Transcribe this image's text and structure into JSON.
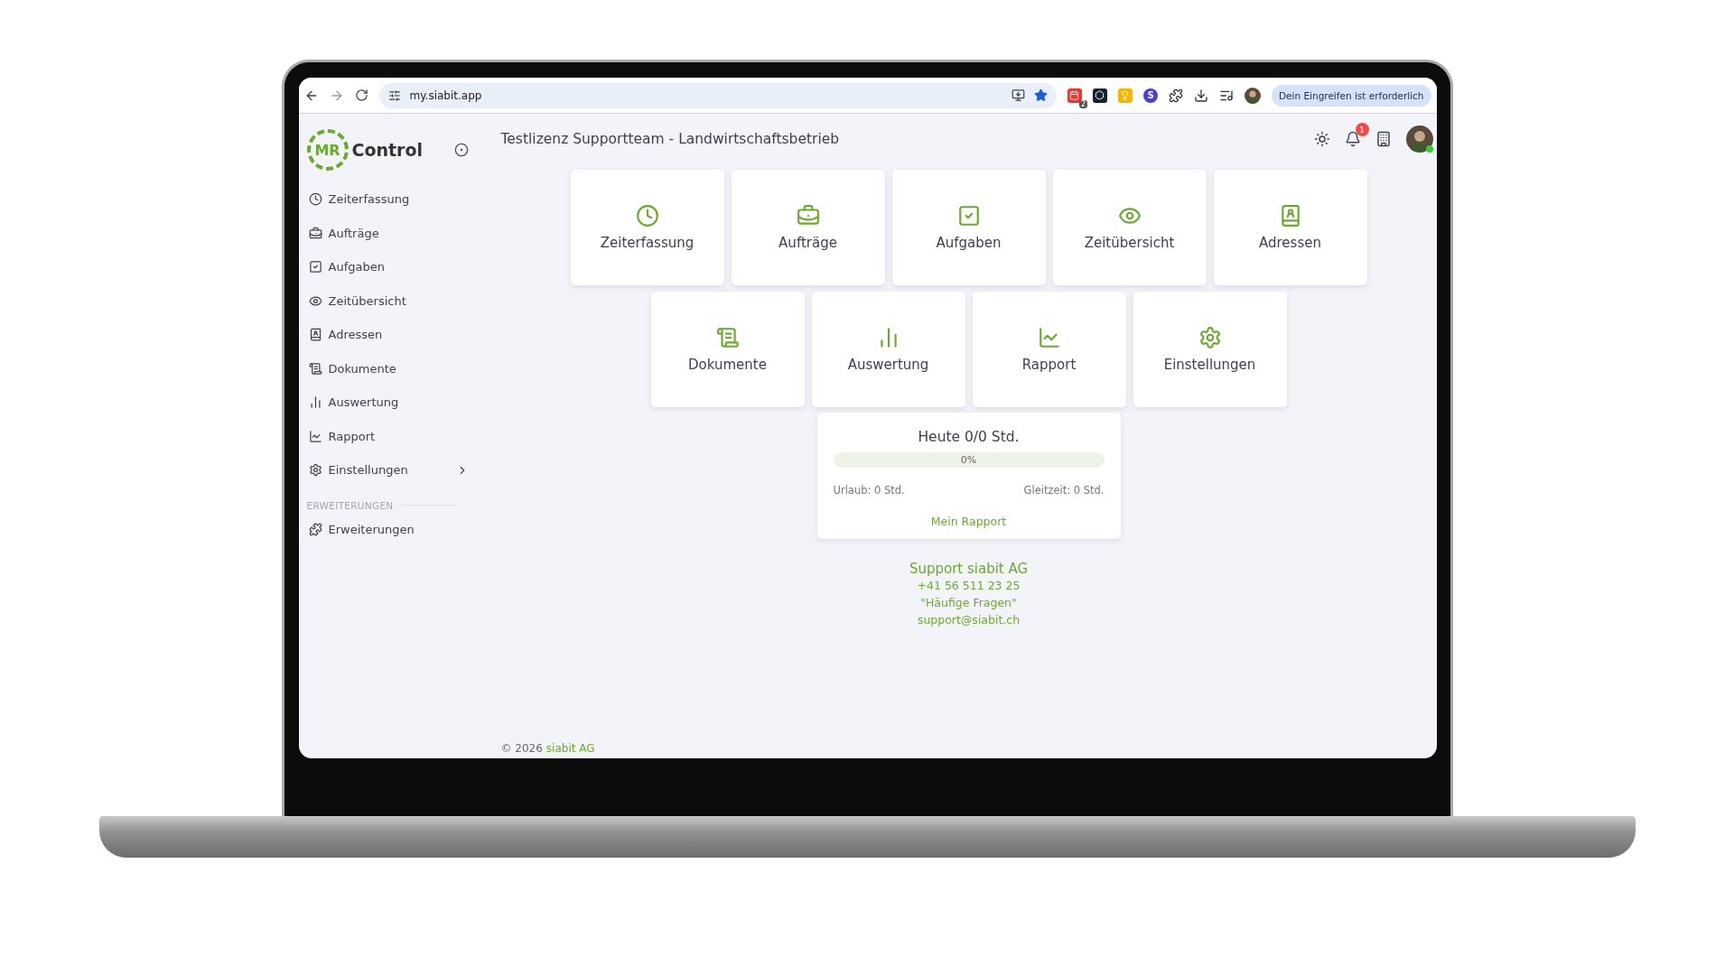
{
  "browser": {
    "url": "my.siabit.app",
    "extensions": [
      {
        "kind": "calendar",
        "badge": "2"
      },
      {
        "kind": "hexagon"
      },
      {
        "kind": "bulb"
      },
      {
        "kind": "letter",
        "letter": "S"
      },
      {
        "kind": "puzzle"
      }
    ],
    "notice": "Dein Eingreifen ist erforderlich"
  },
  "app": {
    "logo": {
      "mark": "MR",
      "name": "Control"
    },
    "header": {
      "title": "Testlizenz Supportteam - Landwirtschaftsbetrieb",
      "notification_count": "1"
    },
    "sidebar": {
      "items": [
        {
          "label": "Zeiterfassung",
          "has_submenu": false
        },
        {
          "label": "Aufträge",
          "has_submenu": false
        },
        {
          "label": "Aufgaben",
          "has_submenu": false
        },
        {
          "label": "Zeitübersicht",
          "has_submenu": false
        },
        {
          "label": "Adressen",
          "has_submenu": false
        },
        {
          "label": "Dokumente",
          "has_submenu": false
        },
        {
          "label": "Auswertung",
          "has_submenu": false
        },
        {
          "label": "Rapport",
          "has_submenu": false
        },
        {
          "label": "Einstellungen",
          "has_submenu": true
        }
      ],
      "section": {
        "title": "ERWEITERUNGEN",
        "items": [
          {
            "label": "Erweiterungen"
          }
        ]
      }
    },
    "tiles": [
      "Zeiterfassung",
      "Aufträge",
      "Aufgaben",
      "Zeitübersicht",
      "Adressen",
      "Dokumente",
      "Auswertung",
      "Rapport",
      "Einstellungen"
    ],
    "summary": {
      "title": "Heute 0/0 Std.",
      "level": 0,
      "reading": "0%",
      "vacation": "Urlaub: 0 Std.",
      "flextime": "Gleitzeit: 0 Std.",
      "link": "Mein Rapport"
    },
    "support": {
      "title": "Support siabit AG",
      "lines": [
        "+41 56 511 23 25",
        "\"Häufige Fragen\"",
        "support@siabit.ch"
      ]
    },
    "footer": {
      "text": "© 2026",
      "link": "siabit AG"
    }
  }
}
